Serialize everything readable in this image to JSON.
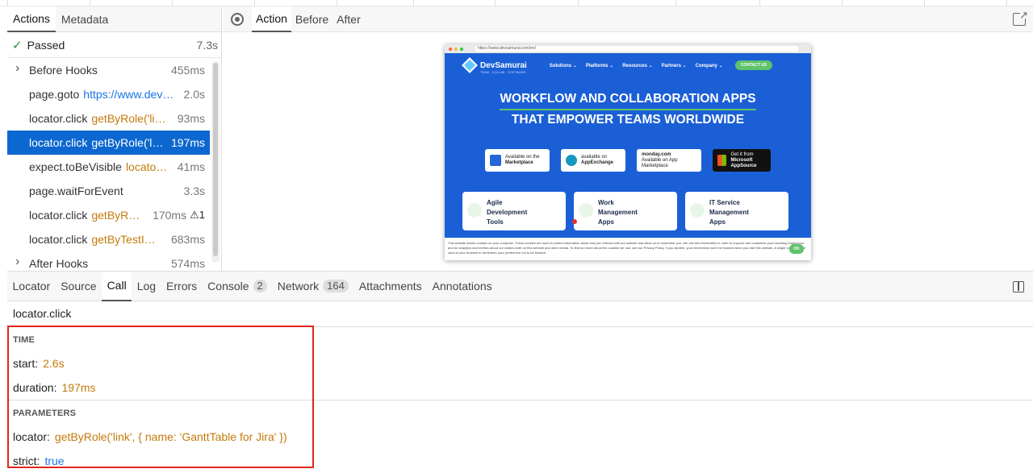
{
  "left_panel": {
    "tabs": [
      "Actions",
      "Metadata"
    ],
    "status": {
      "label": "Passed",
      "duration": "7.3s"
    },
    "actions": [
      {
        "title": "Before Hooks",
        "selector": "",
        "duration": "455ms",
        "expandable": true
      },
      {
        "title": "page.goto",
        "selector": "https://www.dev…",
        "duration": "2.0s",
        "selector_kind": "url"
      },
      {
        "title": "locator.click",
        "selector": "getByRole('li…",
        "duration": "93ms"
      },
      {
        "title": "locator.click",
        "selector": "getByRole('l…",
        "duration": "197ms",
        "selected": true
      },
      {
        "title": "expect.toBeVisible",
        "selector": "locato…",
        "duration": "41ms"
      },
      {
        "title": "page.waitForEvent",
        "selector": "",
        "duration": "3.3s"
      },
      {
        "title": "locator.click",
        "selector": "getByR…",
        "duration": "170ms",
        "warning": "1"
      },
      {
        "title": "locator.click",
        "selector": "getByTestI…",
        "duration": "683ms"
      },
      {
        "title": "After Hooks",
        "selector": "",
        "duration": "574ms",
        "expandable": true
      }
    ]
  },
  "snapshot_tabs": [
    "Action",
    "Before",
    "After"
  ],
  "snapshot": {
    "url": "https://www.devsamurai.com/en/",
    "brand": "DevSamurai",
    "brand_sub": "TEAM · COLLAB · SOFTWARE",
    "menu": [
      "Solutions ⌄",
      "Platforms ⌄",
      "Resources ⌄",
      "Partners ⌄",
      "Company ⌄"
    ],
    "contact": "CONTACT US",
    "headline_1": "WORKFLOW AND COLLABORATION APPS",
    "headline_2": "THAT EMPOWER TEAMS WORLDWIDE",
    "badges": [
      {
        "line1": "Available on the",
        "line2": "Marketplace",
        "color": "#2567d8"
      },
      {
        "line1": "available on",
        "line2": "AppExchange",
        "color": "#1798c1"
      },
      {
        "line1": "monday.com",
        "line2": "Available on App Marketplace",
        "color": "#ff3d57"
      },
      {
        "line1": "Get it from",
        "line2": "Microsoft AppSource",
        "color": "#f25022"
      }
    ],
    "cards": [
      {
        "line1": "Agile",
        "line2": "Development",
        "line3": "Tools"
      },
      {
        "line1": "Work",
        "line2": "Management",
        "line3": "Apps"
      },
      {
        "line1": "IT Service",
        "line2": "Management",
        "line3": "Apps"
      }
    ],
    "cookie_text": "This website stores cookies on your computer. These cookies are used to collect information about how you interact with our website and allow us to remember you. We use this information in order to improve and customize your browsing experience and for analytics and metrics about our visitors both on this website and other media. To find out more about the cookies we use, see our Privacy Policy. If you decline, your information won't be tracked when you visit this website. A single cookie will be used in your browser to remember your preference not to be tracked.",
    "cookie_ok": "OK"
  },
  "bottom_tabs": [
    {
      "label": "Locator"
    },
    {
      "label": "Source"
    },
    {
      "label": "Call",
      "active": true
    },
    {
      "label": "Log"
    },
    {
      "label": "Errors"
    },
    {
      "label": "Console",
      "count": "2"
    },
    {
      "label": "Network",
      "count": "164"
    },
    {
      "label": "Attachments"
    },
    {
      "label": "Annotations"
    }
  ],
  "call": {
    "title": "locator.click",
    "time_heading": "TIME",
    "start_label": "start:",
    "start_value": "2.6s",
    "duration_label": "duration:",
    "duration_value": "197ms",
    "params_heading": "PARAMETERS",
    "locator_label": "locator:",
    "locator_value": "getByRole('link', { name: 'GanttTable for Jira' })",
    "strict_label": "strict:",
    "strict_value": "true"
  },
  "colors": {
    "selected_row": "#0c68d0",
    "highlight": "#e2261e",
    "selector": "#c47a0c",
    "url": "#1a73e8",
    "passed": "#2e8b3d"
  }
}
